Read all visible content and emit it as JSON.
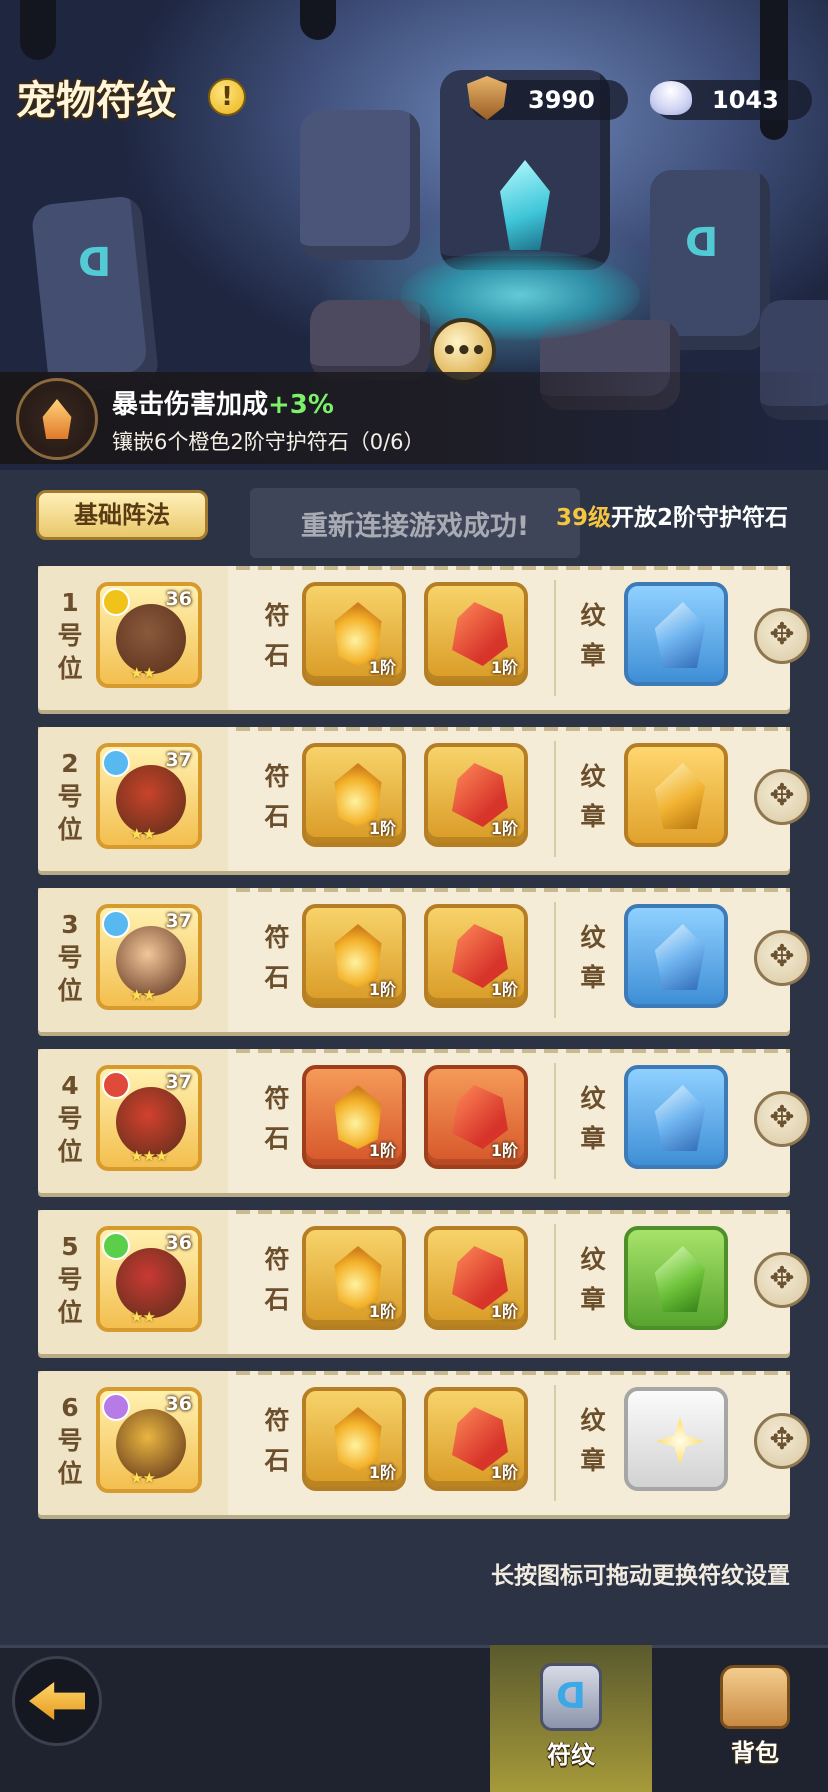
{
  "header": {
    "title": "宠物符纹",
    "info_icon": "exclamation-icon",
    "currencies": [
      {
        "icon": "shield-coin-icon",
        "value": "3990"
      },
      {
        "icon": "shell-icon",
        "value": "1043"
      }
    ]
  },
  "buff": {
    "icon": "flame-rune-icon",
    "title": "暴击伤害加成",
    "bonus": "+3%",
    "requirement": "镶嵌6个橙色2阶守护符石（0/6）"
  },
  "tabs": {
    "base_formation": "基础阵法"
  },
  "toast": "重新连接游戏成功!",
  "unlock_notice": {
    "level": "39级",
    "text": "开放2阶守护符石"
  },
  "column_labels": {
    "rune": "符石",
    "emblem": "纹章"
  },
  "slots": [
    {
      "label": "1号位",
      "pet_level": "36",
      "stars": "★★",
      "rune1_tier": "1阶",
      "rune2_tier": "1阶",
      "emblem": "blue-crystal-emblem",
      "class_color": "#f0c21a",
      "rune_style": "gold"
    },
    {
      "label": "2号位",
      "pet_level": "37",
      "stars": "★★",
      "rune1_tier": "1阶",
      "rune2_tier": "1阶",
      "emblem": "gold-crystal-emblem",
      "class_color": "#58b8f0",
      "rune_style": "gold"
    },
    {
      "label": "3号位",
      "pet_level": "37",
      "stars": "★★",
      "rune1_tier": "1阶",
      "rune2_tier": "1阶",
      "emblem": "blue-crystal-emblem",
      "class_color": "#58b8f0",
      "rune_style": "gold"
    },
    {
      "label": "4号位",
      "pet_level": "37",
      "stars": "★★★",
      "rune1_tier": "1阶",
      "rune2_tier": "1阶",
      "emblem": "blue-crystal-emblem",
      "class_color": "#e04a3a",
      "rune_style": "orange"
    },
    {
      "label": "5号位",
      "pet_level": "36",
      "stars": "★★",
      "rune1_tier": "1阶",
      "rune2_tier": "1阶",
      "emblem": "green-crystal-emblem",
      "class_color": "#5ccf4a",
      "rune_style": "gold"
    },
    {
      "label": "6号位",
      "pet_level": "36",
      "stars": "★★",
      "rune1_tier": "1阶",
      "rune2_tier": "1阶",
      "emblem": "white-star-emblem",
      "class_color": "#b77be8",
      "rune_style": "gold"
    }
  ],
  "hint": "长按图标可拖动更换符纹设置",
  "bottom_nav": {
    "back_icon": "back-arrow-icon",
    "rune_label": "符纹",
    "bag_label": "背包"
  }
}
